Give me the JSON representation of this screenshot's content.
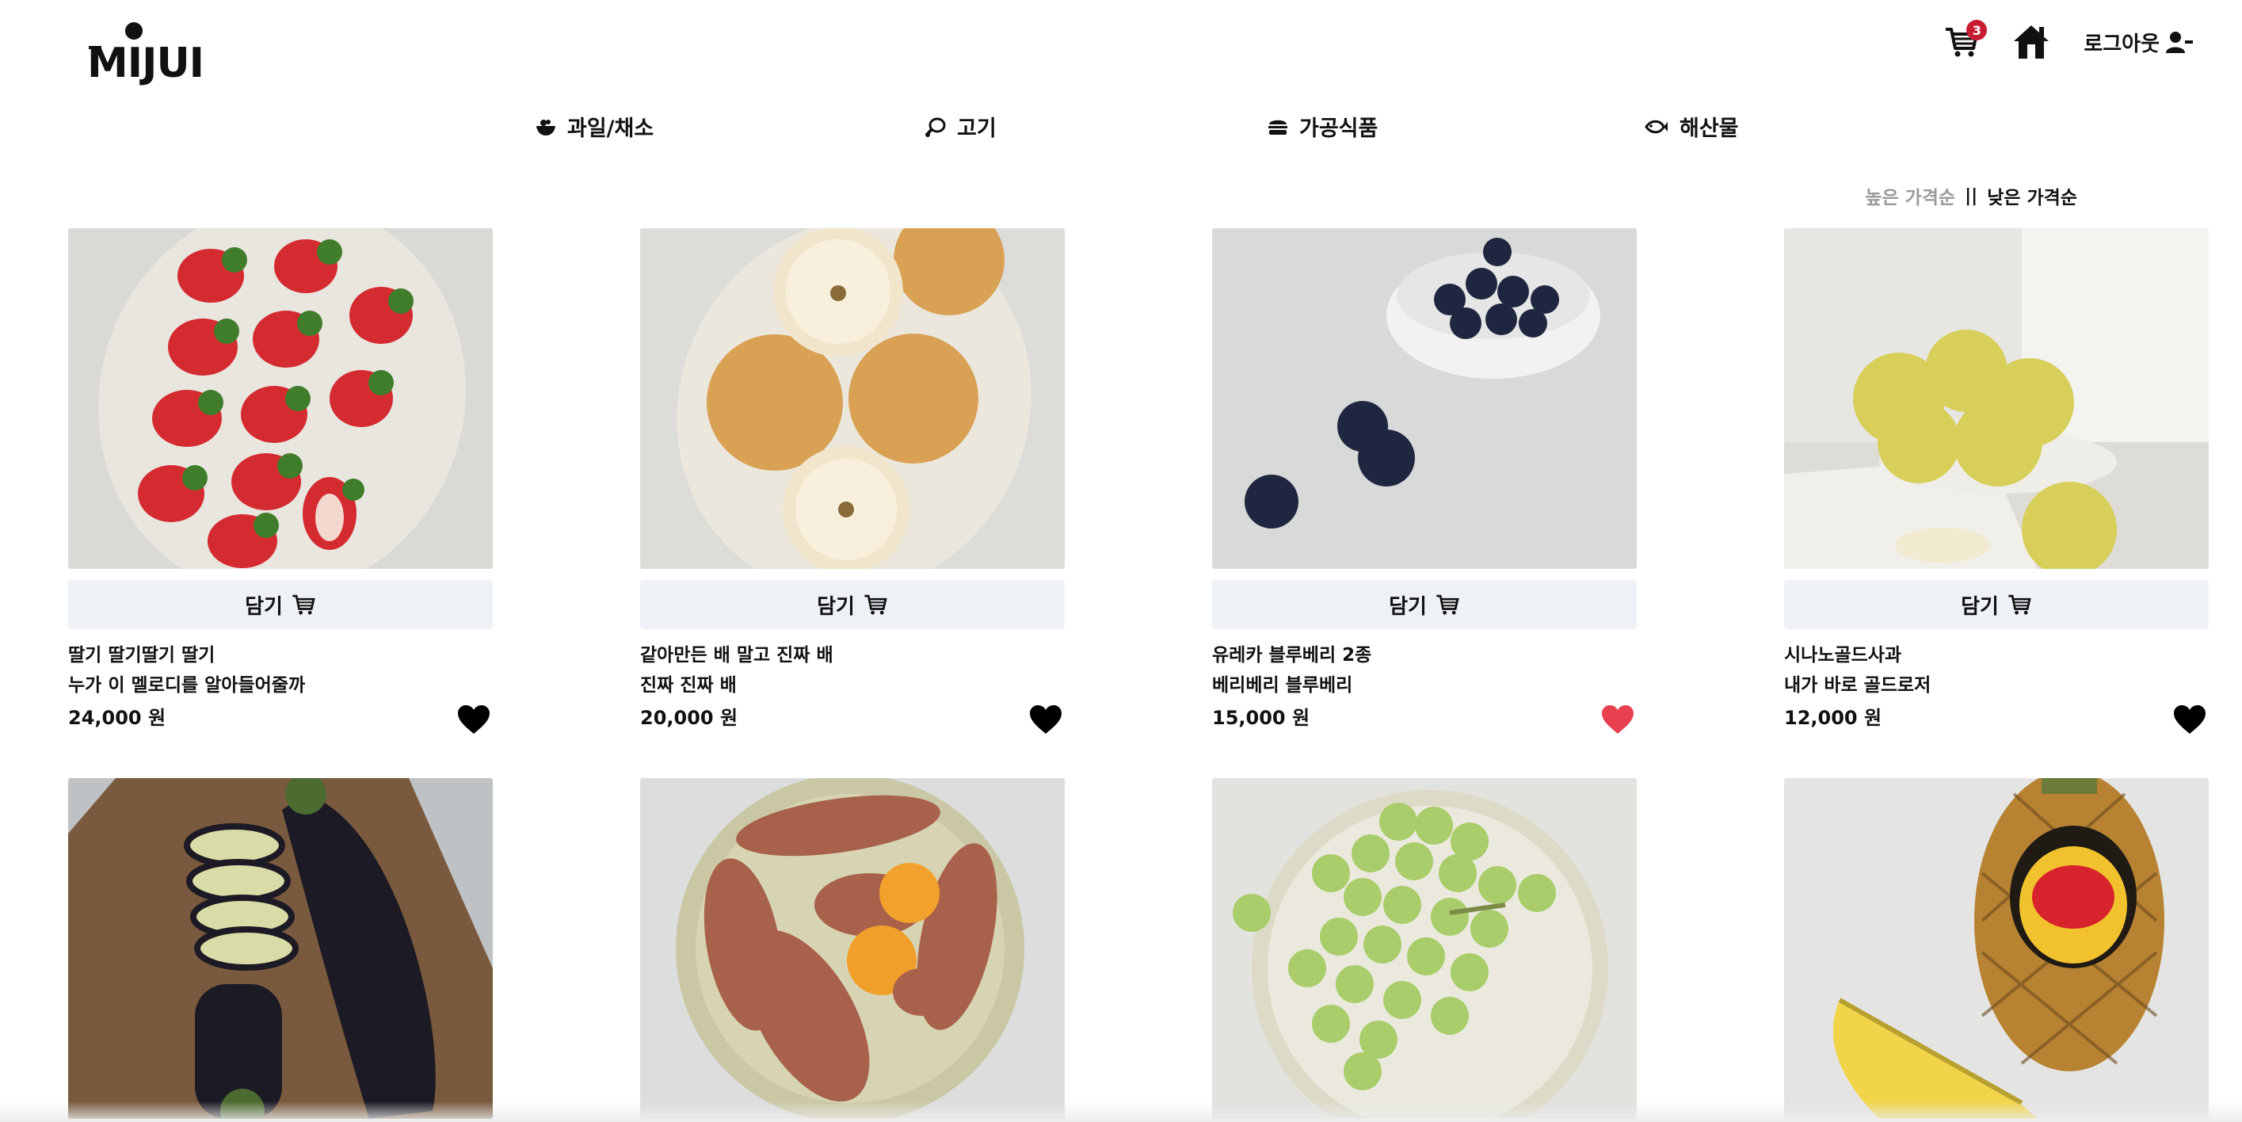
{
  "brand": {
    "logo_text": "MIJUI"
  },
  "header": {
    "cart_count": "3",
    "logout_label": "로그아웃"
  },
  "categories": [
    {
      "label": "과일/채소",
      "icon": "fruit-bowl-icon"
    },
    {
      "label": "고기",
      "icon": "meat-icon"
    },
    {
      "label": "가공식품",
      "icon": "burger-icon"
    },
    {
      "label": "해산물",
      "icon": "fish-icon"
    }
  ],
  "sort": {
    "high_label": "높은 가격순",
    "separator": "||",
    "low_label": "낮은 가격순"
  },
  "products": [
    {
      "line1": "딸기 딸기딸기 딸기",
      "line2": "누가 이 멜로디를 알아들어줄까",
      "price": "24,000 원",
      "cart_label": "담기",
      "liked": false,
      "image": "strawberry"
    },
    {
      "line1": "같아만든 배 말고 진짜 배",
      "line2": "진짜 진짜 배",
      "price": "20,000 원",
      "cart_label": "담기",
      "liked": false,
      "image": "pear"
    },
    {
      "line1": "유레카 블루베리 2종",
      "line2": "베리베리 블루베리",
      "price": "15,000 원",
      "cart_label": "담기",
      "liked": true,
      "image": "blueberry"
    },
    {
      "line1": "시나노골드사과",
      "line2": "내가 바로 골드로저",
      "price": "12,000 원",
      "cart_label": "담기",
      "liked": false,
      "image": "apple"
    },
    {
      "image": "eggplant"
    },
    {
      "image": "sweet-potato"
    },
    {
      "image": "grape"
    },
    {
      "image": "pineapple"
    }
  ],
  "colors": {
    "like_active": "#e8404f",
    "like_inactive": "#000000",
    "badge": "#c81d31",
    "cart_button_bg": "#eef2f7"
  }
}
